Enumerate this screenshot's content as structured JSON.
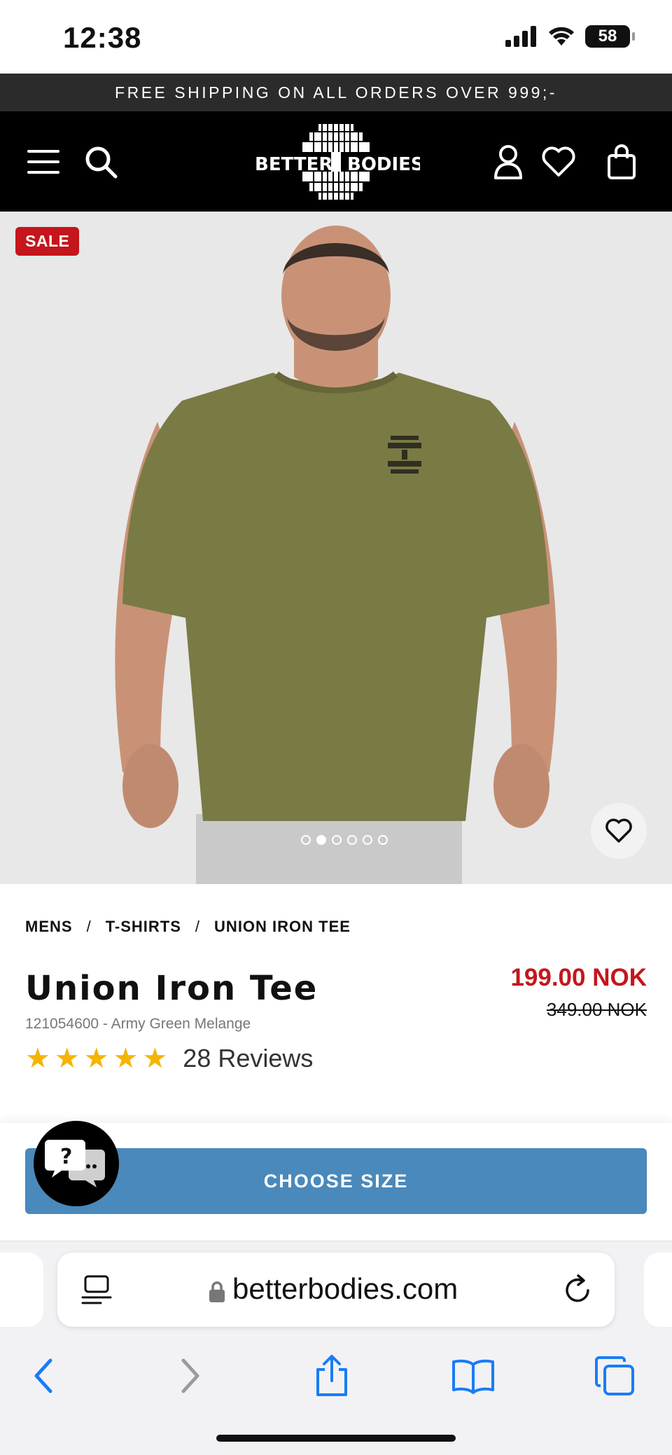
{
  "status_bar": {
    "time": "12:38",
    "battery": "58"
  },
  "promo_banner": {
    "text": "FREE SHIPPING ON ALL ORDERS OVER 999;-"
  },
  "header": {
    "menu_icon": "hamburger-icon",
    "search_icon": "search-icon",
    "logo_text_left": "BETTER",
    "logo_text_right": "BODIES",
    "account_icon": "user-icon",
    "wishlist_icon": "heart-icon",
    "cart_icon": "bag-icon"
  },
  "product_image": {
    "badge": "SALE",
    "slides_total": 6,
    "active_slide": 2,
    "shirt_color": "#7a7a45"
  },
  "breadcrumb": [
    "MENS",
    "T-SHIRTS",
    "UNION IRON TEE"
  ],
  "product": {
    "title": "Union Iron Tee",
    "sku_line": "121054600 - Army Green Melange",
    "stars": 5,
    "reviews": "28 Reviews",
    "price_now": "199.00 NOK",
    "price_old": "349.00 NOK"
  },
  "cta": {
    "choose_size": "CHOOSE SIZE"
  },
  "browser": {
    "url": "betterbodies.com",
    "toolbar": [
      "back",
      "forward",
      "share",
      "bookmarks",
      "tabs"
    ]
  },
  "colors": {
    "sale_red": "#c4161c",
    "cta_blue": "#4a89bb",
    "header_black": "#000000",
    "star_gold": "#f5b400",
    "ios_blue": "#1a7cf5"
  }
}
